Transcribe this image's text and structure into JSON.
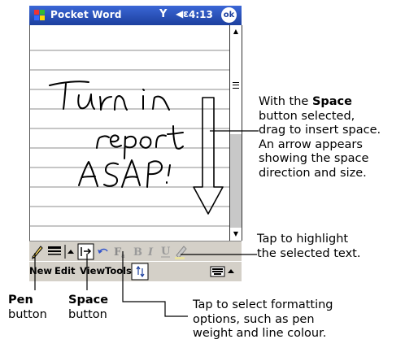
{
  "titlebar": {
    "app_title": "Pocket Word",
    "time": "4:13",
    "ok_label": "ok"
  },
  "menubar": {
    "items": [
      "New",
      "Edit",
      "View",
      "Tools"
    ]
  },
  "toolbar": {
    "bold_label": "B",
    "italic_label": "I",
    "underline_label": "U"
  },
  "handwriting": [
    "Turn in",
    "report",
    "ASAP!"
  ],
  "callouts": {
    "space": {
      "pre": "With the ",
      "bold": "Space",
      "post1": "button selected,",
      "post2": "drag to insert space.",
      "post3": "An arrow appears",
      "post4": "showing the space",
      "post5": "direction and size."
    },
    "highlight": {
      "line1": "Tap to highlight",
      "line2": "the selected text."
    },
    "format": {
      "line1": "Tap to select formatting",
      "line2": "options, such as pen",
      "line3": "weight and line colour."
    },
    "pen": {
      "line1": "Pen",
      "line2": "button"
    },
    "space_btn": {
      "line1": "Space",
      "line2": "button"
    }
  },
  "colors": {
    "titlebar": "#1c3f9e",
    "bar_gray": "#d4d0c8"
  }
}
